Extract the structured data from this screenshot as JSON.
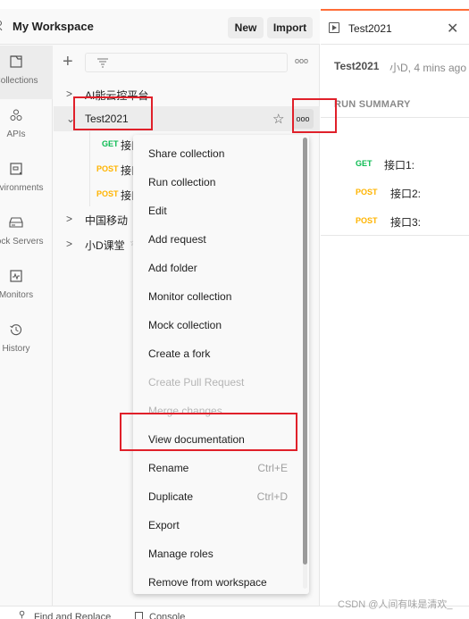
{
  "workspace": {
    "title": "My Workspace",
    "new_label": "New",
    "import_label": "Import"
  },
  "nav": {
    "items": [
      {
        "label": "Collections",
        "icon": "collections-icon",
        "active": true
      },
      {
        "label": "APIs",
        "icon": "apis-icon"
      },
      {
        "label": "Environments",
        "icon": "environments-icon"
      },
      {
        "label": "Mock Servers",
        "icon": "mock-servers-icon"
      },
      {
        "label": "Monitors",
        "icon": "monitors-icon"
      },
      {
        "label": "History",
        "icon": "history-icon"
      }
    ]
  },
  "tree": {
    "more_label": "ooo",
    "collections": [
      {
        "name": "AI能云控平台",
        "expanded": false
      },
      {
        "name": "Test2021",
        "expanded": true,
        "selected": true,
        "requests": [
          {
            "method": "GET",
            "name": "接口1"
          },
          {
            "method": "POST",
            "name": "接口2"
          },
          {
            "method": "POST",
            "name": "接口3"
          }
        ]
      },
      {
        "name": "中国移动",
        "expanded": false
      },
      {
        "name": "小D课堂",
        "expanded": false,
        "shared": true
      }
    ]
  },
  "context_menu": {
    "items": [
      {
        "label": "Share collection"
      },
      {
        "label": "Run collection"
      },
      {
        "label": "Edit"
      },
      {
        "label": "Add request"
      },
      {
        "label": "Add folder"
      },
      {
        "label": "Monitor collection"
      },
      {
        "label": "Mock collection"
      },
      {
        "label": "Create a fork"
      },
      {
        "label": "Create Pull Request",
        "disabled": true
      },
      {
        "label": "Merge changes",
        "disabled": true
      },
      {
        "label": "View documentation",
        "highlighted": true
      },
      {
        "label": "Rename",
        "shortcut": "Ctrl+E"
      },
      {
        "label": "Duplicate",
        "shortcut": "Ctrl+D"
      },
      {
        "label": "Export"
      },
      {
        "label": "Manage roles"
      },
      {
        "label": "Remove from workspace"
      }
    ]
  },
  "runner": {
    "tab_title": "Test2021",
    "run_title": "Test2021",
    "run_meta": "小D, 4 mins ago",
    "summary_heading": "RUN SUMMARY",
    "results": [
      {
        "method": "GET",
        "name": "接口1:"
      },
      {
        "method": "POST",
        "name": "接口2:"
      },
      {
        "method": "POST",
        "name": "接口3:"
      }
    ]
  },
  "status_bar": {
    "find_label": "Find and Replace",
    "console_label": "Console"
  },
  "watermark": "CSDN @人间有味是清欢_",
  "colors": {
    "accent": "#ff6c37",
    "get": "#0cbb52",
    "post": "#ffb400",
    "annotation": "#e0202a"
  }
}
